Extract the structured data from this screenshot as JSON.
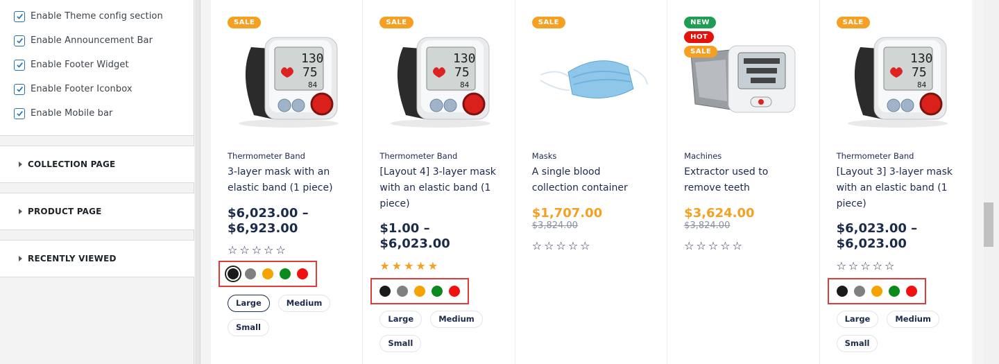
{
  "sidebar": {
    "checks": [
      {
        "label": "Enable Theme config section"
      },
      {
        "label": "Enable Announcement Bar"
      },
      {
        "label": "Enable Footer Widget"
      },
      {
        "label": "Enable Footer Iconbox"
      },
      {
        "label": "Enable Mobile bar"
      }
    ],
    "sections": [
      {
        "title": "COLLECTION PAGE"
      },
      {
        "title": "PRODUCT PAGE"
      },
      {
        "title": "RECENTLY VIEWED"
      }
    ]
  },
  "colors": {
    "sale_badge": "#f5a023",
    "new_badge": "#1f9d55",
    "hot_badge": "#e3120b",
    "brand_dark": "#1c2a4b",
    "accent": "#f5a023",
    "highlight_box": "#e03a3a"
  },
  "swatch_colors": [
    "#1a1a1a",
    "#808080",
    "#f5a300",
    "#0a8a1e",
    "#f20f0f"
  ],
  "products": [
    {
      "badges": [
        "SALE"
      ],
      "image": "blood-pressure-monitor-image",
      "category": "Thermometer Band",
      "title": "3-layer mask with an elastic band (1 piece)",
      "price": "$6,023.00 –",
      "price2": "$6,923.00",
      "old_price": "",
      "rating": 0,
      "sizes": [
        "Large",
        "Medium",
        "Small"
      ],
      "selected_size": "Large"
    },
    {
      "badges": [
        "SALE"
      ],
      "image": "blood-pressure-monitor-image",
      "category": "Thermometer Band",
      "title": "[Layout 4] 3-layer mask with an elastic band (1 piece)",
      "price": "$1.00 –",
      "price2": "$6,023.00",
      "old_price": "",
      "rating": 5,
      "sizes": [
        "Large",
        "Medium",
        "Small"
      ],
      "selected_size": ""
    },
    {
      "badges": [
        "SALE"
      ],
      "image": "face-mask-image",
      "category": "Masks",
      "title": "A single blood collection container",
      "price": "$1,707.00",
      "price2": "",
      "old_price": "$3,824.00",
      "rating": 0,
      "sizes": [],
      "selected_size": ""
    },
    {
      "badges": [
        "NEW",
        "HOT",
        "SALE"
      ],
      "image": "wrist-monitor-image",
      "category": "Machines",
      "title": "Extractor used to remove teeth",
      "price": "$3,624.00",
      "price2": "",
      "old_price": "$3,824.00",
      "rating": 0,
      "sizes": [],
      "selected_size": ""
    },
    {
      "badges": [
        "SALE"
      ],
      "image": "blood-pressure-monitor-image",
      "category": "Thermometer Band",
      "title": "[Layout 3] 3-layer mask with an elastic band (1 piece)",
      "price": "$6,023.00 –",
      "price2": "$6,023.00",
      "old_price": "",
      "rating": 0,
      "sizes": [
        "Large",
        "Medium",
        "Small"
      ],
      "selected_size": ""
    }
  ],
  "monitor_readout": {
    "sys": "130",
    "dia": "75",
    "pulse": "84"
  }
}
